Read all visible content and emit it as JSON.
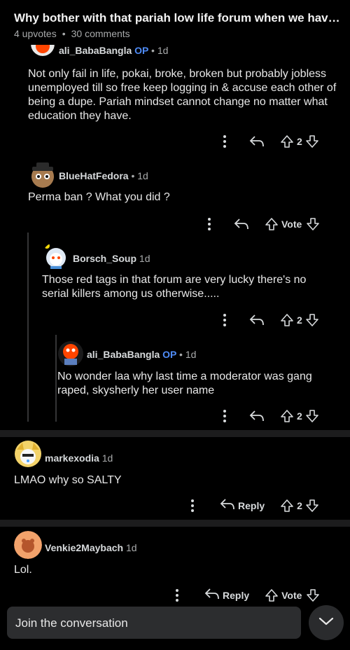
{
  "post": {
    "title": "Why bother with that pariah low life forum when we have red...",
    "upvotes": "4 upvotes",
    "dot": "•",
    "comments": "30 comments"
  },
  "comments": [
    {
      "username": "ali_BabaBangla",
      "op": "OP",
      "age": "• 1d",
      "text": "Not only fail in life, pokai, broke, broken but probably jobless unemployed till so free keep logging in & accuse each other of being a dupe. Pariah mindset cannot change no matter what education they have.",
      "score": "2"
    },
    {
      "username": "BlueHatFedora",
      "age": "• 1d",
      "text": "Perma ban ? What you did ?",
      "vote_label": "Vote"
    },
    {
      "username": "Borsch_Soup",
      "age": "1d",
      "text": "Those red tags in that forum are very lucky there's no serial killers among us otherwise.....",
      "score": "2"
    },
    {
      "username": "ali_BabaBangla",
      "op": "OP",
      "age": "• 1d",
      "text": "No wonder laa why last time a moderator was gang raped, skysherly her user name",
      "score": "2"
    },
    {
      "username": "markexodia",
      "age": "1d",
      "text": "LMAO why so SALTY",
      "reply_label": "Reply",
      "score": "2"
    },
    {
      "username": "Venkie2Maybach",
      "age": "1d",
      "text": "Lol.",
      "reply_label": "Reply",
      "vote_label": "Vote"
    }
  ],
  "composer": {
    "placeholder": "Join the conversation"
  },
  "icons": {
    "more": "more-vertical-icon",
    "share": "share-arrow-icon",
    "reply": "reply-arrow-icon",
    "upvote": "upvote-arrow-icon",
    "downvote": "downvote-arrow-icon",
    "collapse": "chevron-down-icon"
  },
  "colors": {
    "background": "#000000",
    "op_accent": "#4f8cf7",
    "separator": "#1c1c1d",
    "composer_bg": "#2c2d2f"
  }
}
